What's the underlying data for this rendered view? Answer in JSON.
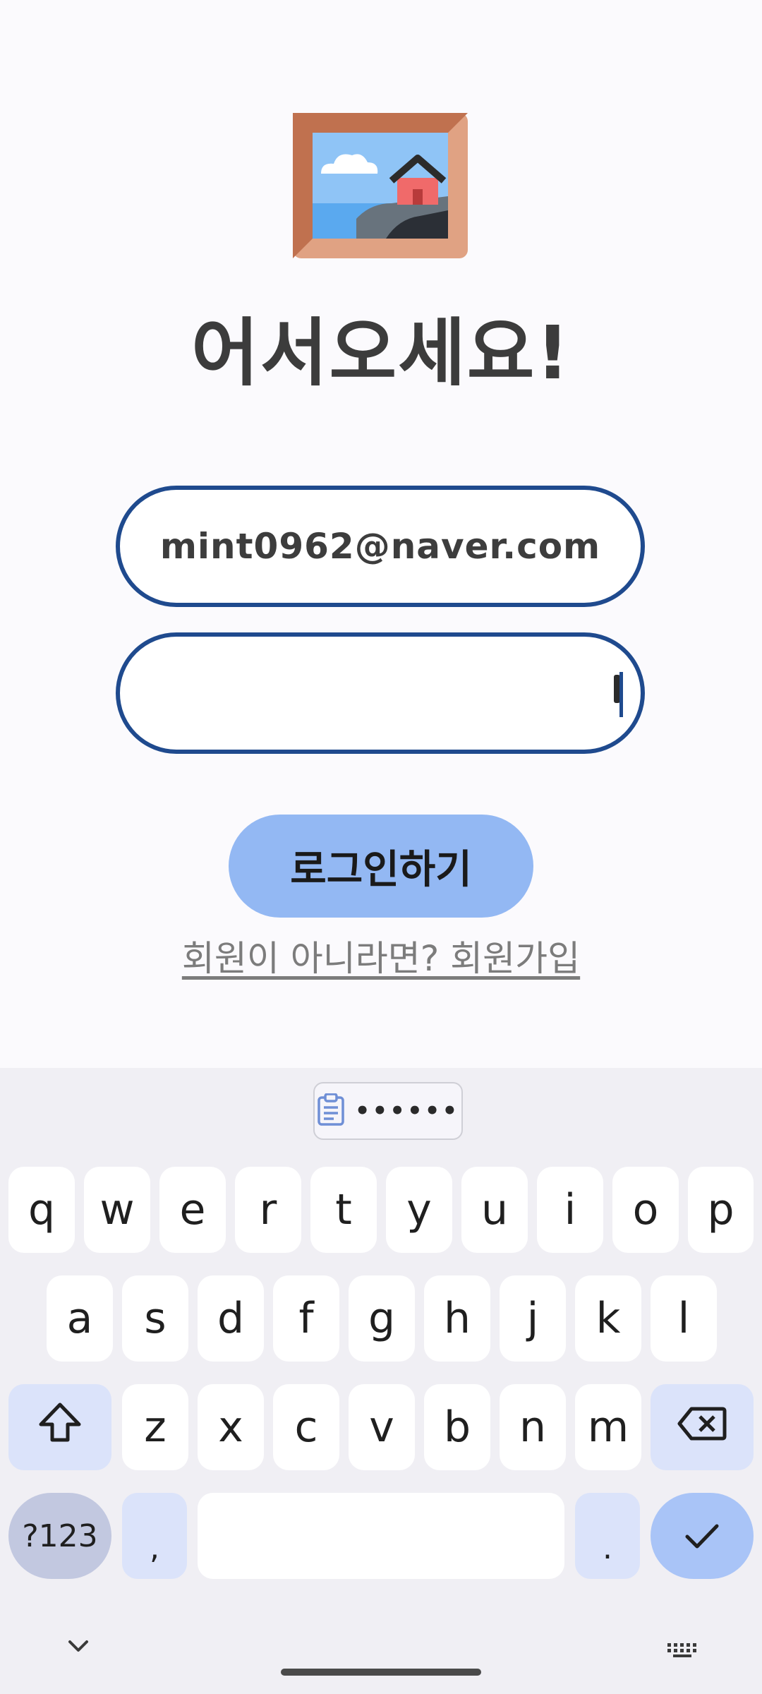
{
  "header": {
    "logo_icon": "framed-picture-icon",
    "title": "어서오세요!"
  },
  "form": {
    "email_value": "mint0962@naver.com",
    "password_value": "",
    "login_label": "로그인하기",
    "signup_link": "회원이 아니라면? 회원가입"
  },
  "keyboard": {
    "clipboard_icon": "clipboard-icon",
    "clipboard_preview": "••••••",
    "row1": [
      "q",
      "w",
      "e",
      "r",
      "t",
      "y",
      "u",
      "i",
      "o",
      "p"
    ],
    "row2": [
      "a",
      "s",
      "d",
      "f",
      "g",
      "h",
      "j",
      "k",
      "l"
    ],
    "row3": [
      "z",
      "x",
      "c",
      "v",
      "b",
      "n",
      "m"
    ],
    "symbols_label": "?123",
    "comma_label": ",",
    "period_label": ".",
    "shift_icon": "shift-icon",
    "backspace_icon": "backspace-icon",
    "enter_icon": "checkmark-icon"
  },
  "colors": {
    "field_border": "#1f4a8e",
    "login_button": "#93b8f3",
    "keyboard_bg": "#f0eff4"
  }
}
